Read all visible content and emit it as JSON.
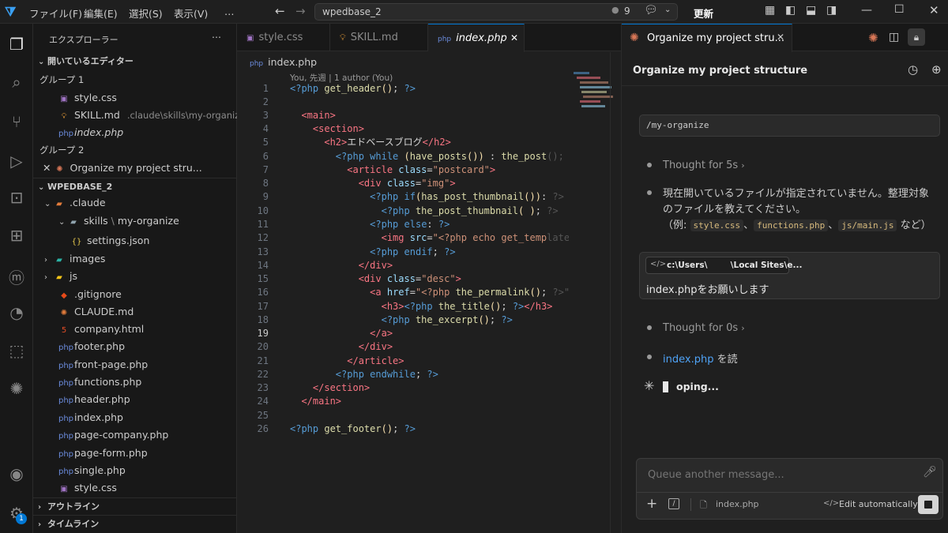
{
  "titlebar": {
    "menu": [
      "ファイル(F)",
      "編集(E)",
      "選択(S)",
      "表示(V)",
      "…"
    ],
    "search": "wpedbase_2",
    "badge_count": "9",
    "update_label": "更新"
  },
  "sidebar": {
    "title": "エクスプローラー",
    "open_editors": "開いているエディター",
    "group1": "グループ 1",
    "group2": "グループ 2",
    "open_files": [
      {
        "name": "style.css",
        "path": ""
      },
      {
        "name": "SKILL.md",
        "path": ".claude\\skills\\my-organize"
      },
      {
        "name": "index.php",
        "path": ""
      }
    ],
    "group2_item": "Organize my project stru...",
    "project": "WPEDBASE_2",
    "tree": [
      {
        "name": ".claude",
        "depth": 1
      },
      {
        "name": "skills",
        "path2": "my-organize",
        "depth": 2
      },
      {
        "name": "settings.json",
        "depth": 3
      },
      {
        "name": "images",
        "depth": 1
      },
      {
        "name": "js",
        "depth": 1
      },
      {
        "name": ".gitignore",
        "depth": 1
      },
      {
        "name": "CLAUDE.md",
        "depth": 1
      },
      {
        "name": "company.html",
        "depth": 1
      },
      {
        "name": "footer.php",
        "depth": 1
      },
      {
        "name": "front-page.php",
        "depth": 1
      },
      {
        "name": "functions.php",
        "depth": 1
      },
      {
        "name": "header.php",
        "depth": 1
      },
      {
        "name": "index.php",
        "depth": 1
      },
      {
        "name": "page-company.php",
        "depth": 1
      },
      {
        "name": "page-form.php",
        "depth": 1
      },
      {
        "name": "single.php",
        "depth": 1
      },
      {
        "name": "style.css",
        "depth": 1
      }
    ],
    "outline": "アウトライン",
    "timeline": "タイムライン"
  },
  "editor": {
    "tabs": [
      "style.css",
      "SKILL.md",
      "index.php"
    ],
    "breadcrumb": "index.php",
    "blame": "You, 先週 | 1 author (You)",
    "current_line": "19"
  },
  "chat": {
    "tab_title": "Organize my project stru...",
    "header_title": "Organize my project structure",
    "command": "/my-organize",
    "thought1": "Thought for 5s",
    "reply_line1": "現在開いているファイルが指定されていません。整理対象",
    "reply_line2": "のファイルを教えてください。",
    "reply_ex_prefix": "（例: ",
    "ex1": "style.css",
    "sep1": "、",
    "ex2": "functions.php",
    "sep2": "、",
    "ex3": "js/main.js",
    "reply_ex_suffix": " など）",
    "attachment": "c:\\Users\\        \\Local Sites\\e...",
    "user_msg": "index.phpをお願いします",
    "thought2": "Thought for 0s",
    "read_file": "index.php",
    "read_suffix": " を読",
    "status": "oping...",
    "input_placeholder": "Queue another message...",
    "context_file": "index.php",
    "edit_mode": "Edit automatically"
  },
  "colors": {
    "accent": "#0078d4",
    "claude": "#d97757"
  }
}
